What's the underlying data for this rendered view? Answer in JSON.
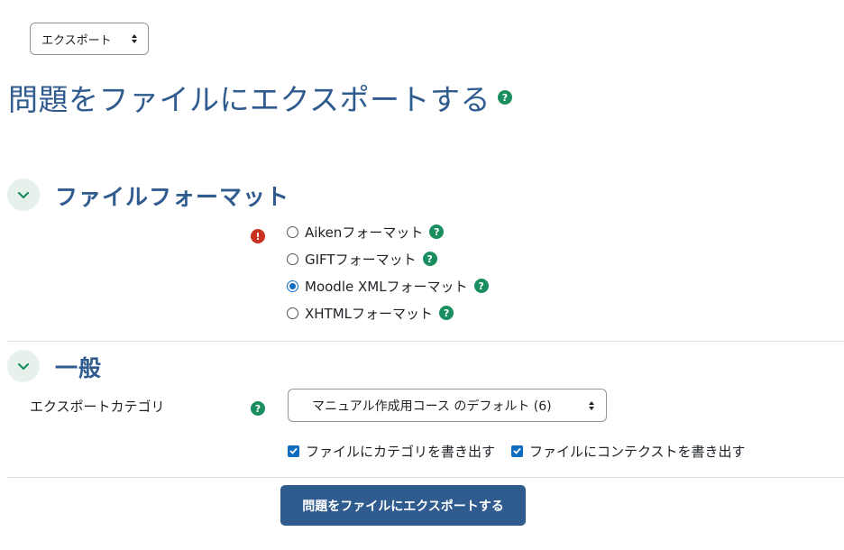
{
  "nav_select": {
    "value": "エクスポート"
  },
  "page": {
    "title": "問題をファイルにエクスポートする"
  },
  "sections": {
    "file_format": {
      "title": "ファイルフォーマット",
      "options": [
        {
          "label": "Aikenフォーマット",
          "checked": false
        },
        {
          "label": "GIFTフォーマット",
          "checked": false
        },
        {
          "label": "Moodle XMLフォーマット",
          "checked": true
        },
        {
          "label": "XHTMLフォーマット",
          "checked": false
        }
      ]
    },
    "general": {
      "title": "一般",
      "category_label": "エクスポートカテゴリ",
      "category_value": "マニュアル作成用コース のデフォルト (6)",
      "checkbox_category": {
        "label": "ファイルにカテゴリを書き出す",
        "checked": true
      },
      "checkbox_context": {
        "label": "ファイルにコンテクストを書き出す",
        "checked": true
      }
    }
  },
  "submit": {
    "label": "問題をファイルにエクスポートする"
  },
  "colors": {
    "accent": "#2f5b8f",
    "help": "#1a8e5f",
    "error": "#ca3120",
    "checkbox": "#0f6cbf"
  },
  "icons": {
    "help": "?",
    "error": "!"
  }
}
